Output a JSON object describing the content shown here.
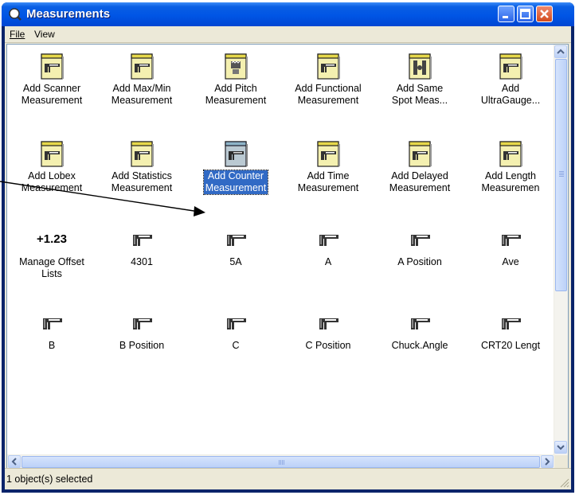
{
  "window": {
    "title": "Measurements"
  },
  "menu": {
    "file": "File",
    "view": "View"
  },
  "items": [
    {
      "label": "Add Scanner Measurement",
      "line1": "Add Scanner",
      "line2": "Measurement",
      "icon": "notebook-caliper-icon"
    },
    {
      "label": "Add Max/Min Measurement",
      "line1": "Add Max/Min",
      "line2": "Measurement",
      "icon": "notebook-caliper-icon"
    },
    {
      "label": "Add Pitch Measurement",
      "line1": "Add Pitch",
      "line2": "Measurement",
      "icon": "notebook-thread-icon"
    },
    {
      "label": "Add Functional Measurement",
      "line1": "Add Functional",
      "line2": "Measurement",
      "icon": "notebook-caliper-icon"
    },
    {
      "label": "Add Same Spot Meas...",
      "line1": "Add Same",
      "line2": "Spot Meas...",
      "icon": "notebook-gauge-icon"
    },
    {
      "label": "Add UltraGauge...",
      "line1": "Add",
      "line2": "UltraGauge...",
      "icon": "notebook-caliper-icon"
    },
    {
      "label": "Add Lobex Measurement",
      "line1": "Add Lobex",
      "line2": "Measurement",
      "icon": "notebook-caliper-icon"
    },
    {
      "label": "Add Statistics Measurement",
      "line1": "Add Statistics",
      "line2": "Measurement",
      "icon": "notebook-caliper-icon"
    },
    {
      "label": "Add Counter Measurement",
      "line1": "Add Counter",
      "line2": "Measurement",
      "icon": "notebook-caliper-icon"
    },
    {
      "label": "Add Time Measurement",
      "line1": "Add Time",
      "line2": "Measurement",
      "icon": "notebook-caliper-icon"
    },
    {
      "label": "Add Delayed Measurement",
      "line1": "Add Delayed",
      "line2": "Measurement",
      "icon": "notebook-caliper-icon"
    },
    {
      "label": "Add Length Measuremen",
      "line1": "Add Length",
      "line2": "Measuremen",
      "icon": "notebook-caliper-icon"
    },
    {
      "label": "Manage Offset Lists",
      "line1": "Manage Offset",
      "line2": "Lists",
      "icon": "offset-text-icon",
      "icon_text": "+1.23"
    },
    {
      "label": "4301",
      "line1": "4301",
      "line2": "",
      "icon": "caliper-icon"
    },
    {
      "label": "5A",
      "line1": "5A",
      "line2": "",
      "icon": "caliper-icon"
    },
    {
      "label": "A",
      "line1": "A",
      "line2": "",
      "icon": "caliper-icon"
    },
    {
      "label": "A Position",
      "line1": "A Position",
      "line2": "",
      "icon": "caliper-icon"
    },
    {
      "label": "Ave",
      "line1": "Ave",
      "line2": "",
      "icon": "caliper-icon"
    },
    {
      "label": "B",
      "line1": "B",
      "line2": "",
      "icon": "caliper-icon"
    },
    {
      "label": "B Position",
      "line1": "B Position",
      "line2": "",
      "icon": "caliper-icon"
    },
    {
      "label": "C",
      "line1": "C",
      "line2": "",
      "icon": "caliper-icon"
    },
    {
      "label": "C Position",
      "line1": "C Position",
      "line2": "",
      "icon": "caliper-icon"
    },
    {
      "label": "Chuck.Angle",
      "line1": "Chuck.Angle",
      "line2": "",
      "icon": "caliper-icon"
    },
    {
      "label": "CRT20 Lengt",
      "line1": "CRT20 Lengt",
      "line2": "",
      "icon": "caliper-icon"
    }
  ],
  "selected_index": 8,
  "status": {
    "text": "1 object(s) selected"
  },
  "colors": {
    "title_blue": "#0054E3",
    "selection": "#316AC5",
    "chrome": "#ECE9D8"
  }
}
